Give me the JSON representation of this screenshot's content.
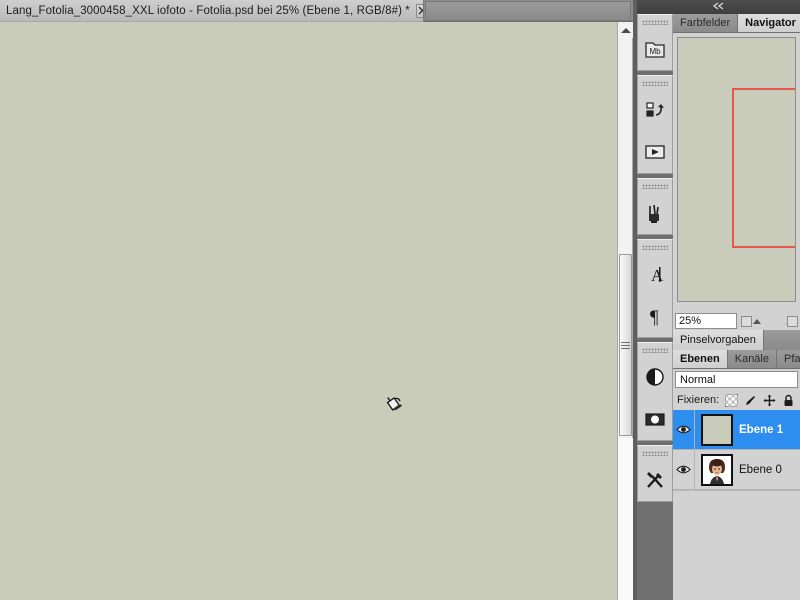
{
  "document_tab": {
    "title": "Lang_Fotolia_3000458_XXL iofoto - Fotolia.psd bei 25% (Ebene 1, RGB/8#) *",
    "close_label": "✕",
    "close_icon": "close-icon"
  },
  "canvas": {
    "fill_color": "#c9cbbb",
    "cursor_icon": "paint-bucket-cursor"
  },
  "scrollbar": {
    "up_arrow_icon": "triangle-up-icon",
    "thumb_grip_icon": "grip-lines-icon"
  },
  "dock": {
    "collapse_icon": "double-chevron-left-icon",
    "collapse_label": "◀◀",
    "rail_groups": [
      {
        "items": [
          {
            "label": "Mb",
            "icon": "mini-bridge-icon",
            "name": "rail-mini-bridge"
          }
        ]
      },
      {
        "items": [
          {
            "label": "",
            "icon": "history-icon",
            "name": "rail-history"
          },
          {
            "label": "",
            "icon": "actions-play-icon",
            "name": "rail-actions"
          }
        ]
      },
      {
        "items": [
          {
            "label": "",
            "icon": "brush-icon",
            "name": "rail-brush"
          }
        ]
      },
      {
        "items": [
          {
            "label": "A",
            "icon": "character-icon",
            "name": "rail-character"
          },
          {
            "label": "¶",
            "icon": "paragraph-icon",
            "name": "rail-paragraph"
          }
        ]
      },
      {
        "items": [
          {
            "label": "",
            "icon": "adjustments-icon",
            "name": "rail-adjustments"
          },
          {
            "label": "",
            "icon": "masks-icon",
            "name": "rail-masks"
          }
        ]
      },
      {
        "items": [
          {
            "label": "",
            "icon": "tools-icon",
            "name": "rail-tools"
          }
        ]
      }
    ]
  },
  "navigator_group": {
    "tabs": [
      {
        "label": "Farbfelder",
        "active": false
      },
      {
        "label": "Navigator",
        "active": true
      }
    ],
    "view_rect_color": "#e8554a",
    "zoom_value": "25%",
    "zoom_out_icon": "zoom-out-icon",
    "zoom_in_icon": "zoom-in-icon",
    "slider_icon": "zoom-slider-icon"
  },
  "brush_presets": {
    "tab_label": "Pinselvorgaben"
  },
  "layers_group": {
    "tabs": [
      {
        "label": "Ebenen",
        "active": true
      },
      {
        "label": "Kanäle",
        "active": false
      },
      {
        "label": "Pfade",
        "active": false
      }
    ],
    "blend_mode": "Normal",
    "lock_label": "Fixieren:",
    "lock_icons": [
      {
        "name": "lock-transparency-icon",
        "icon": "checkerboard-icon"
      },
      {
        "name": "lock-pixels-icon",
        "icon": "brush-icon"
      },
      {
        "name": "lock-position-icon",
        "icon": "move-cross-icon"
      },
      {
        "name": "lock-all-icon",
        "icon": "padlock-icon"
      }
    ],
    "layers": [
      {
        "name": "Ebene 1",
        "selected": true,
        "visible": true,
        "thumb": "solid-sage",
        "eye_icon": "eye-icon"
      },
      {
        "name": "Ebene 0",
        "selected": false,
        "visible": true,
        "thumb": "portrait-woman",
        "eye_icon": "eye-icon"
      }
    ]
  }
}
